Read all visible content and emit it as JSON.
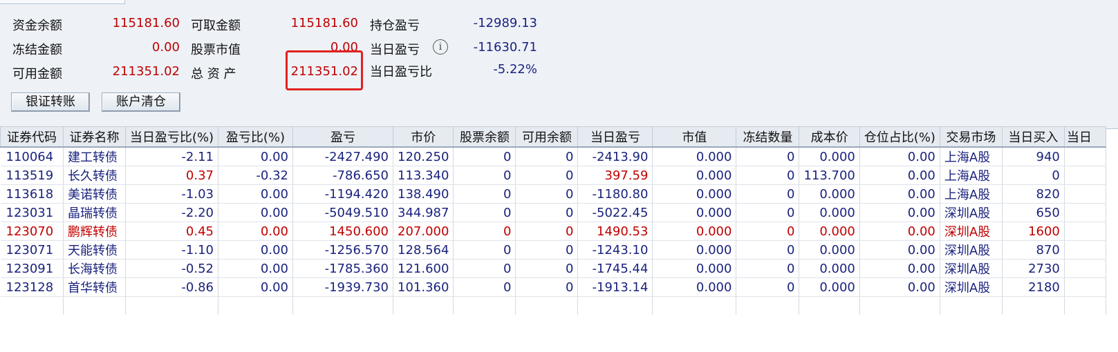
{
  "summary": {
    "fund_balance_label": "资金余额",
    "fund_balance": "115181.60",
    "frozen_label": "冻结金额",
    "frozen": "0.00",
    "available_label": "可用金额",
    "available": "211351.02",
    "withdrawable_label": "可取金额",
    "withdrawable": "115181.60",
    "stock_value_label": "股票市值",
    "stock_value": "0.00",
    "total_assets_label": "总 资 产",
    "total_assets": "211351.02",
    "position_pl_label": "持仓盈亏",
    "position_pl": "-12989.13",
    "daily_pl_label": "当日盈亏",
    "daily_pl": "-11630.71",
    "daily_pl_ratio_label": "当日盈亏比",
    "daily_pl_ratio": "-5.22%",
    "info_icon": "i"
  },
  "buttons": {
    "bank_transfer": "银证转账",
    "clear_account": "账户清仓"
  },
  "table": {
    "headers": [
      "证券代码",
      "证券名称",
      "当日盈亏比(%)",
      "盈亏比(%)",
      "盈亏",
      "市价",
      "股票余额",
      "可用余额",
      "当日盈亏",
      "市值",
      "冻结数量",
      "成本价",
      "仓位占比(%)",
      "交易市场",
      "当日买入",
      "当日"
    ],
    "rows": [
      [
        "110064",
        "建工转债",
        "-2.11",
        "0.00",
        "-2427.490",
        "120.250",
        "0",
        "0",
        "-2413.90",
        "0.000",
        "0",
        "0.000",
        "0.00",
        "上海A股",
        "940"
      ],
      [
        "113519",
        "长久转债",
        "0.37",
        "-0.32",
        "-786.650",
        "113.340",
        "0",
        "0",
        "397.59",
        "0.000",
        "0",
        "113.700",
        "0.00",
        "上海A股",
        "0"
      ],
      [
        "113618",
        "美诺转债",
        "-1.03",
        "0.00",
        "-1194.420",
        "138.490",
        "0",
        "0",
        "-1180.80",
        "0.000",
        "0",
        "0.000",
        "0.00",
        "上海A股",
        "820"
      ],
      [
        "123031",
        "晶瑞转债",
        "-2.20",
        "0.00",
        "-5049.510",
        "344.987",
        "0",
        "0",
        "-5022.45",
        "0.000",
        "0",
        "0.000",
        "0.00",
        "深圳A股",
        "650"
      ],
      [
        "123070",
        "鹏辉转债",
        "0.45",
        "0.00",
        "1450.600",
        "207.000",
        "0",
        "0",
        "1490.53",
        "0.000",
        "0",
        "0.000",
        "0.00",
        "深圳A股",
        "1600"
      ],
      [
        "123071",
        "天能转债",
        "-1.10",
        "0.00",
        "-1256.570",
        "128.564",
        "0",
        "0",
        "-1243.10",
        "0.000",
        "0",
        "0.000",
        "0.00",
        "深圳A股",
        "870"
      ],
      [
        "123091",
        "长海转债",
        "-0.52",
        "0.00",
        "-1785.360",
        "121.600",
        "0",
        "0",
        "-1745.44",
        "0.000",
        "0",
        "0.000",
        "0.00",
        "深圳A股",
        "2730"
      ],
      [
        "123128",
        "首华转债",
        "-0.86",
        "0.00",
        "-1939.730",
        "101.360",
        "0",
        "0",
        "-1913.14",
        "0.000",
        "0",
        "0.000",
        "0.00",
        "深圳A股",
        "2180"
      ]
    ]
  }
}
